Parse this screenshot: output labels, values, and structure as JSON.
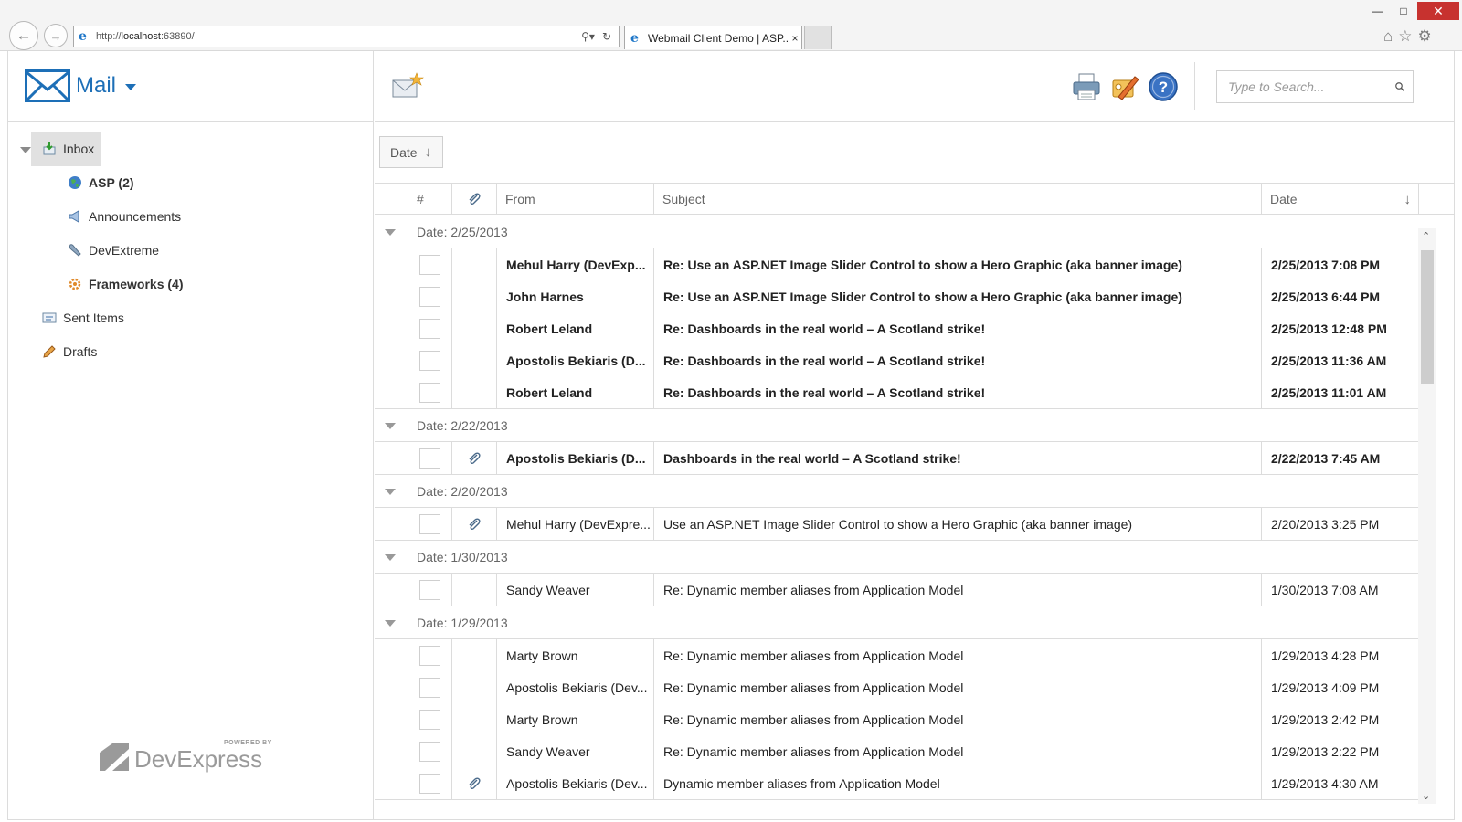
{
  "browser": {
    "url_prefix": "http://",
    "url_host": "localhost",
    "url_rest": ":63890/",
    "tab_title": "Webmail Client Demo | ASP...",
    "tab_close": "×"
  },
  "app": {
    "title": "Mail",
    "search_placeholder": "Type to Search...",
    "grouping_label": "Date",
    "brand_powered": "POWERED BY",
    "brand_name": "DevExpress"
  },
  "folders": [
    {
      "label": "Inbox",
      "icon": "inbox-icon",
      "bold": false
    },
    {
      "label": "ASP (2)",
      "icon": "globe-icon",
      "bold": true
    },
    {
      "label": "Announcements",
      "icon": "megaphone-icon",
      "bold": false
    },
    {
      "label": "DevExtreme",
      "icon": "wrench-icon",
      "bold": false
    },
    {
      "label": "Frameworks (4)",
      "icon": "gear-icon",
      "bold": true
    },
    {
      "label": "Sent Items",
      "icon": "sent-icon",
      "bold": false
    },
    {
      "label": "Drafts",
      "icon": "pencil-icon",
      "bold": false
    }
  ],
  "grid": {
    "columns": {
      "hash": "#",
      "from": "From",
      "subject": "Subject",
      "date": "Date"
    },
    "groups": [
      {
        "label": "Date: 2/25/2013",
        "rows": [
          {
            "from": "Mehul Harry (DevExp...",
            "subject": "Re: Use an ASP.NET Image Slider Control to show a Hero Graphic (aka banner image)",
            "date": "2/25/2013 7:08 PM",
            "unread": true,
            "attachment": false
          },
          {
            "from": "John Harnes",
            "subject": "Re: Use an ASP.NET Image Slider Control to show a Hero Graphic (aka banner image)",
            "date": "2/25/2013 6:44 PM",
            "unread": true,
            "attachment": false
          },
          {
            "from": "Robert Leland",
            "subject": "Re: Dashboards in the real world – A Scotland strike!",
            "date": "2/25/2013 12:48 PM",
            "unread": true,
            "attachment": false
          },
          {
            "from": "Apostolis Bekiaris (D...",
            "subject": "Re: Dashboards in the real world – A Scotland strike!",
            "date": "2/25/2013 11:36 AM",
            "unread": true,
            "attachment": false
          },
          {
            "from": "Robert Leland",
            "subject": "Re: Dashboards in the real world – A Scotland strike!",
            "date": "2/25/2013 11:01 AM",
            "unread": true,
            "attachment": false
          }
        ]
      },
      {
        "label": "Date: 2/22/2013",
        "rows": [
          {
            "from": "Apostolis Bekiaris (D...",
            "subject": "Dashboards in the real world – A Scotland strike!",
            "date": "2/22/2013 7:45 AM",
            "unread": true,
            "attachment": true
          }
        ]
      },
      {
        "label": "Date: 2/20/2013",
        "rows": [
          {
            "from": "Mehul Harry (DevExpre...",
            "subject": "Use an ASP.NET Image Slider Control to show a Hero Graphic (aka banner image)",
            "date": "2/20/2013 3:25 PM",
            "unread": false,
            "attachment": true
          }
        ]
      },
      {
        "label": "Date: 1/30/2013",
        "rows": [
          {
            "from": "Sandy Weaver",
            "subject": "Re: Dynamic member aliases from Application Model",
            "date": "1/30/2013 7:08 AM",
            "unread": false,
            "attachment": false
          }
        ]
      },
      {
        "label": "Date: 1/29/2013",
        "rows": [
          {
            "from": "Marty Brown",
            "subject": "Re: Dynamic member aliases from Application Model",
            "date": "1/29/2013 4:28 PM",
            "unread": false,
            "attachment": false
          },
          {
            "from": "Apostolis Bekiaris (Dev...",
            "subject": "Re: Dynamic member aliases from Application Model",
            "date": "1/29/2013 4:09 PM",
            "unread": false,
            "attachment": false
          },
          {
            "from": "Marty Brown",
            "subject": "Re: Dynamic member aliases from Application Model",
            "date": "1/29/2013 2:42 PM",
            "unread": false,
            "attachment": false
          },
          {
            "from": "Sandy Weaver",
            "subject": "Re: Dynamic member aliases from Application Model",
            "date": "1/29/2013 2:22 PM",
            "unread": false,
            "attachment": false
          },
          {
            "from": "Apostolis Bekiaris (Dev...",
            "subject": "Dynamic member aliases from Application Model",
            "date": "1/29/2013 4:30 AM",
            "unread": false,
            "attachment": true
          }
        ]
      }
    ]
  },
  "colors": {
    "accent": "#1d6fb7",
    "border": "#dcdcdc",
    "selected": "#e1e1e1"
  }
}
